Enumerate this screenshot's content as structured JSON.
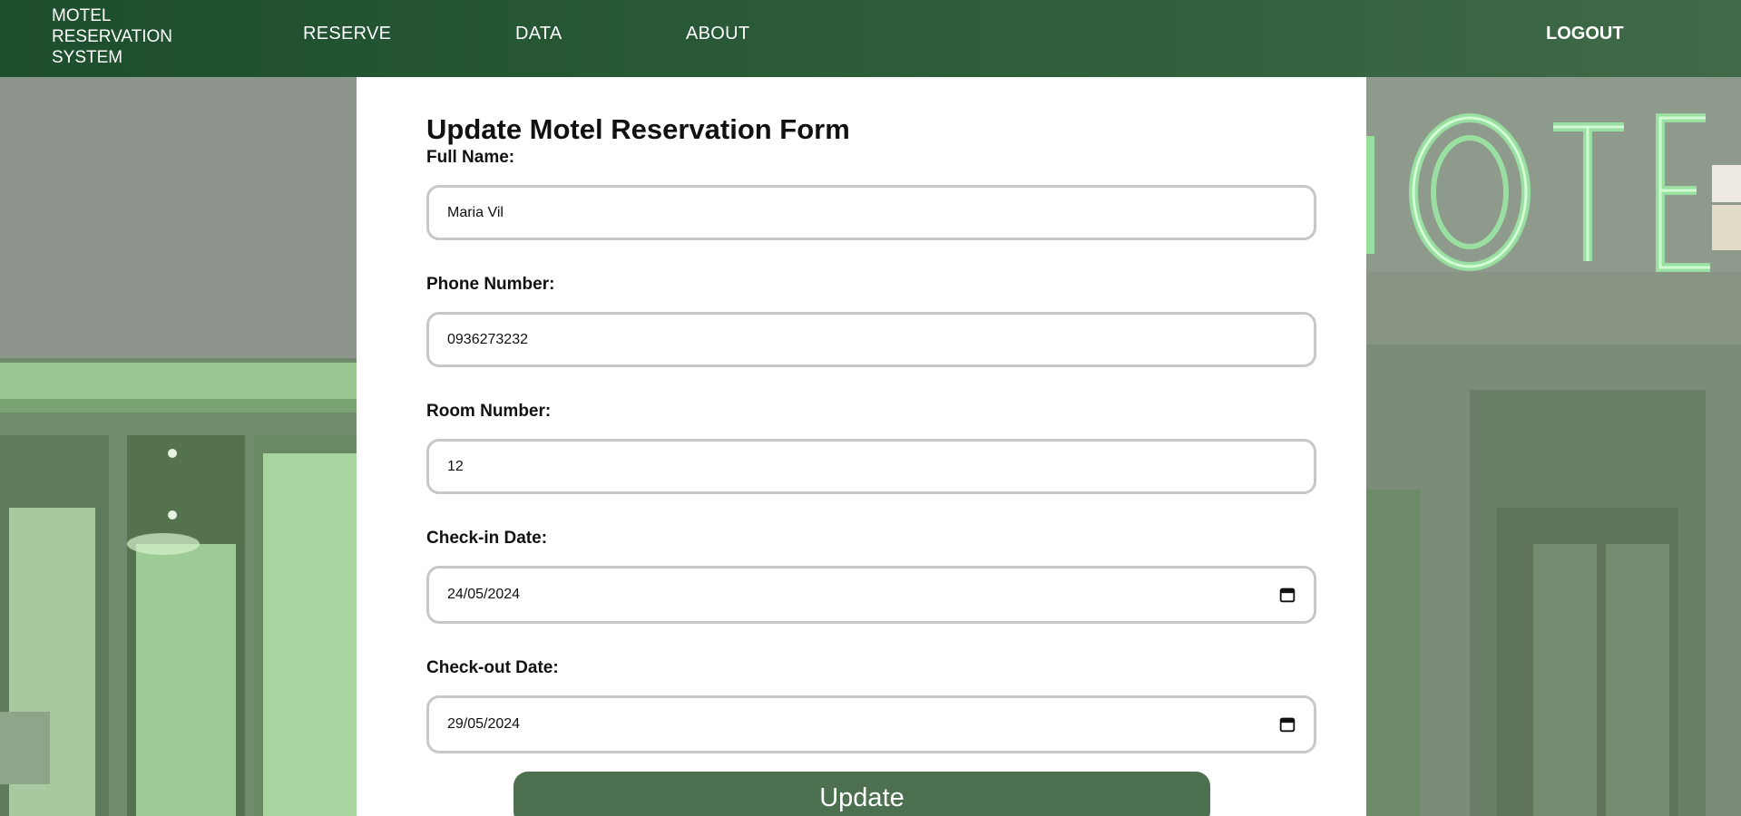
{
  "navbar": {
    "brand_line1": "MOTEL",
    "brand_line2": "RESERVATION",
    "brand_line3": "SYSTEM",
    "links": [
      "RESERVE",
      "DATA",
      "ABOUT"
    ],
    "logout": "LOGOUT"
  },
  "form": {
    "title": "Update Motel Reservation Form",
    "fields": [
      {
        "label": "Full Name:",
        "value": "Maria Vil",
        "type": "text"
      },
      {
        "label": "Phone Number:",
        "value": "0936273232",
        "type": "text"
      },
      {
        "label": "Room Number:",
        "value": "12",
        "type": "text"
      },
      {
        "label": "Check-in Date:",
        "value": "24/05/2024",
        "type": "date"
      },
      {
        "label": "Check-out Date:",
        "value": "29/05/2024",
        "type": "date"
      }
    ],
    "submit_label": "Update"
  },
  "background": {
    "sign_text": "MOTEL",
    "icons": [
      "calendar-icon"
    ]
  },
  "colors": {
    "nav_dark": "#1d4e2d",
    "nav_light": "#3f6a49",
    "button": "#4d7050",
    "neon": "#9be7a4"
  }
}
